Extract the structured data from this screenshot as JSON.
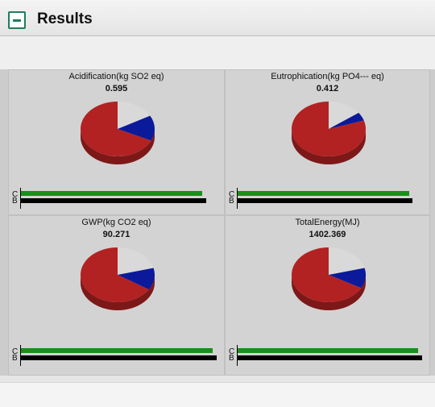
{
  "title": "Results",
  "legend_swatches": [
    {
      "name": "red-swatch",
      "color": "#b22222"
    },
    {
      "name": "gray-swatch",
      "color": "#d3d3d3"
    },
    {
      "name": "navy-swatch",
      "color": "#0a1a9a"
    },
    {
      "name": "orange-swatch",
      "color": "#ffa500"
    },
    {
      "name": "teal-swatch",
      "color": "#1a9a8a"
    }
  ],
  "toolbar_icons": [
    "refresh-icon",
    "chart-export-icon",
    "save-check-icon",
    "remove-icon",
    "export-icon"
  ],
  "chart_data": [
    {
      "type": "pie",
      "title": "Acidification(kg SO2 eq)",
      "total": "0.595",
      "slices": [
        {
          "color": "#b22222",
          "value": 0.68
        },
        {
          "color": "#d9d9d9",
          "value": 0.17
        },
        {
          "color": "#0a1a9a",
          "value": 0.15
        }
      ],
      "bars": {
        "categories": [
          "C",
          "B"
        ],
        "values": [
          0.92,
          0.94
        ]
      }
    },
    {
      "type": "pie",
      "title": "Eutrophication(kg PO4--- eq)",
      "total": "0.412",
      "slices": [
        {
          "color": "#b22222",
          "value": 0.8
        },
        {
          "color": "#d9d9d9",
          "value": 0.15
        },
        {
          "color": "#0a1a9a",
          "value": 0.05
        }
      ],
      "bars": {
        "categories": [
          "C",
          "B"
        ],
        "values": [
          0.92,
          0.94
        ]
      }
    },
    {
      "type": "pie",
      "title": "GWP(kg CO2 eq)",
      "total": "90.271",
      "slices": [
        {
          "color": "#b22222",
          "value": 0.66
        },
        {
          "color": "#d9d9d9",
          "value": 0.21
        },
        {
          "color": "#0a1a9a",
          "value": 0.13
        }
      ],
      "bars": {
        "categories": [
          "C",
          "B"
        ],
        "values": [
          0.97,
          0.99
        ]
      }
    },
    {
      "type": "pie",
      "title": "TotalEnergy(MJ)",
      "total": "1402.369",
      "slices": [
        {
          "color": "#b22222",
          "value": 0.67
        },
        {
          "color": "#d9d9d9",
          "value": 0.21
        },
        {
          "color": "#0a1a9a",
          "value": 0.12
        }
      ],
      "bars": {
        "categories": [
          "C",
          "B"
        ],
        "values": [
          0.97,
          0.99
        ]
      }
    }
  ]
}
